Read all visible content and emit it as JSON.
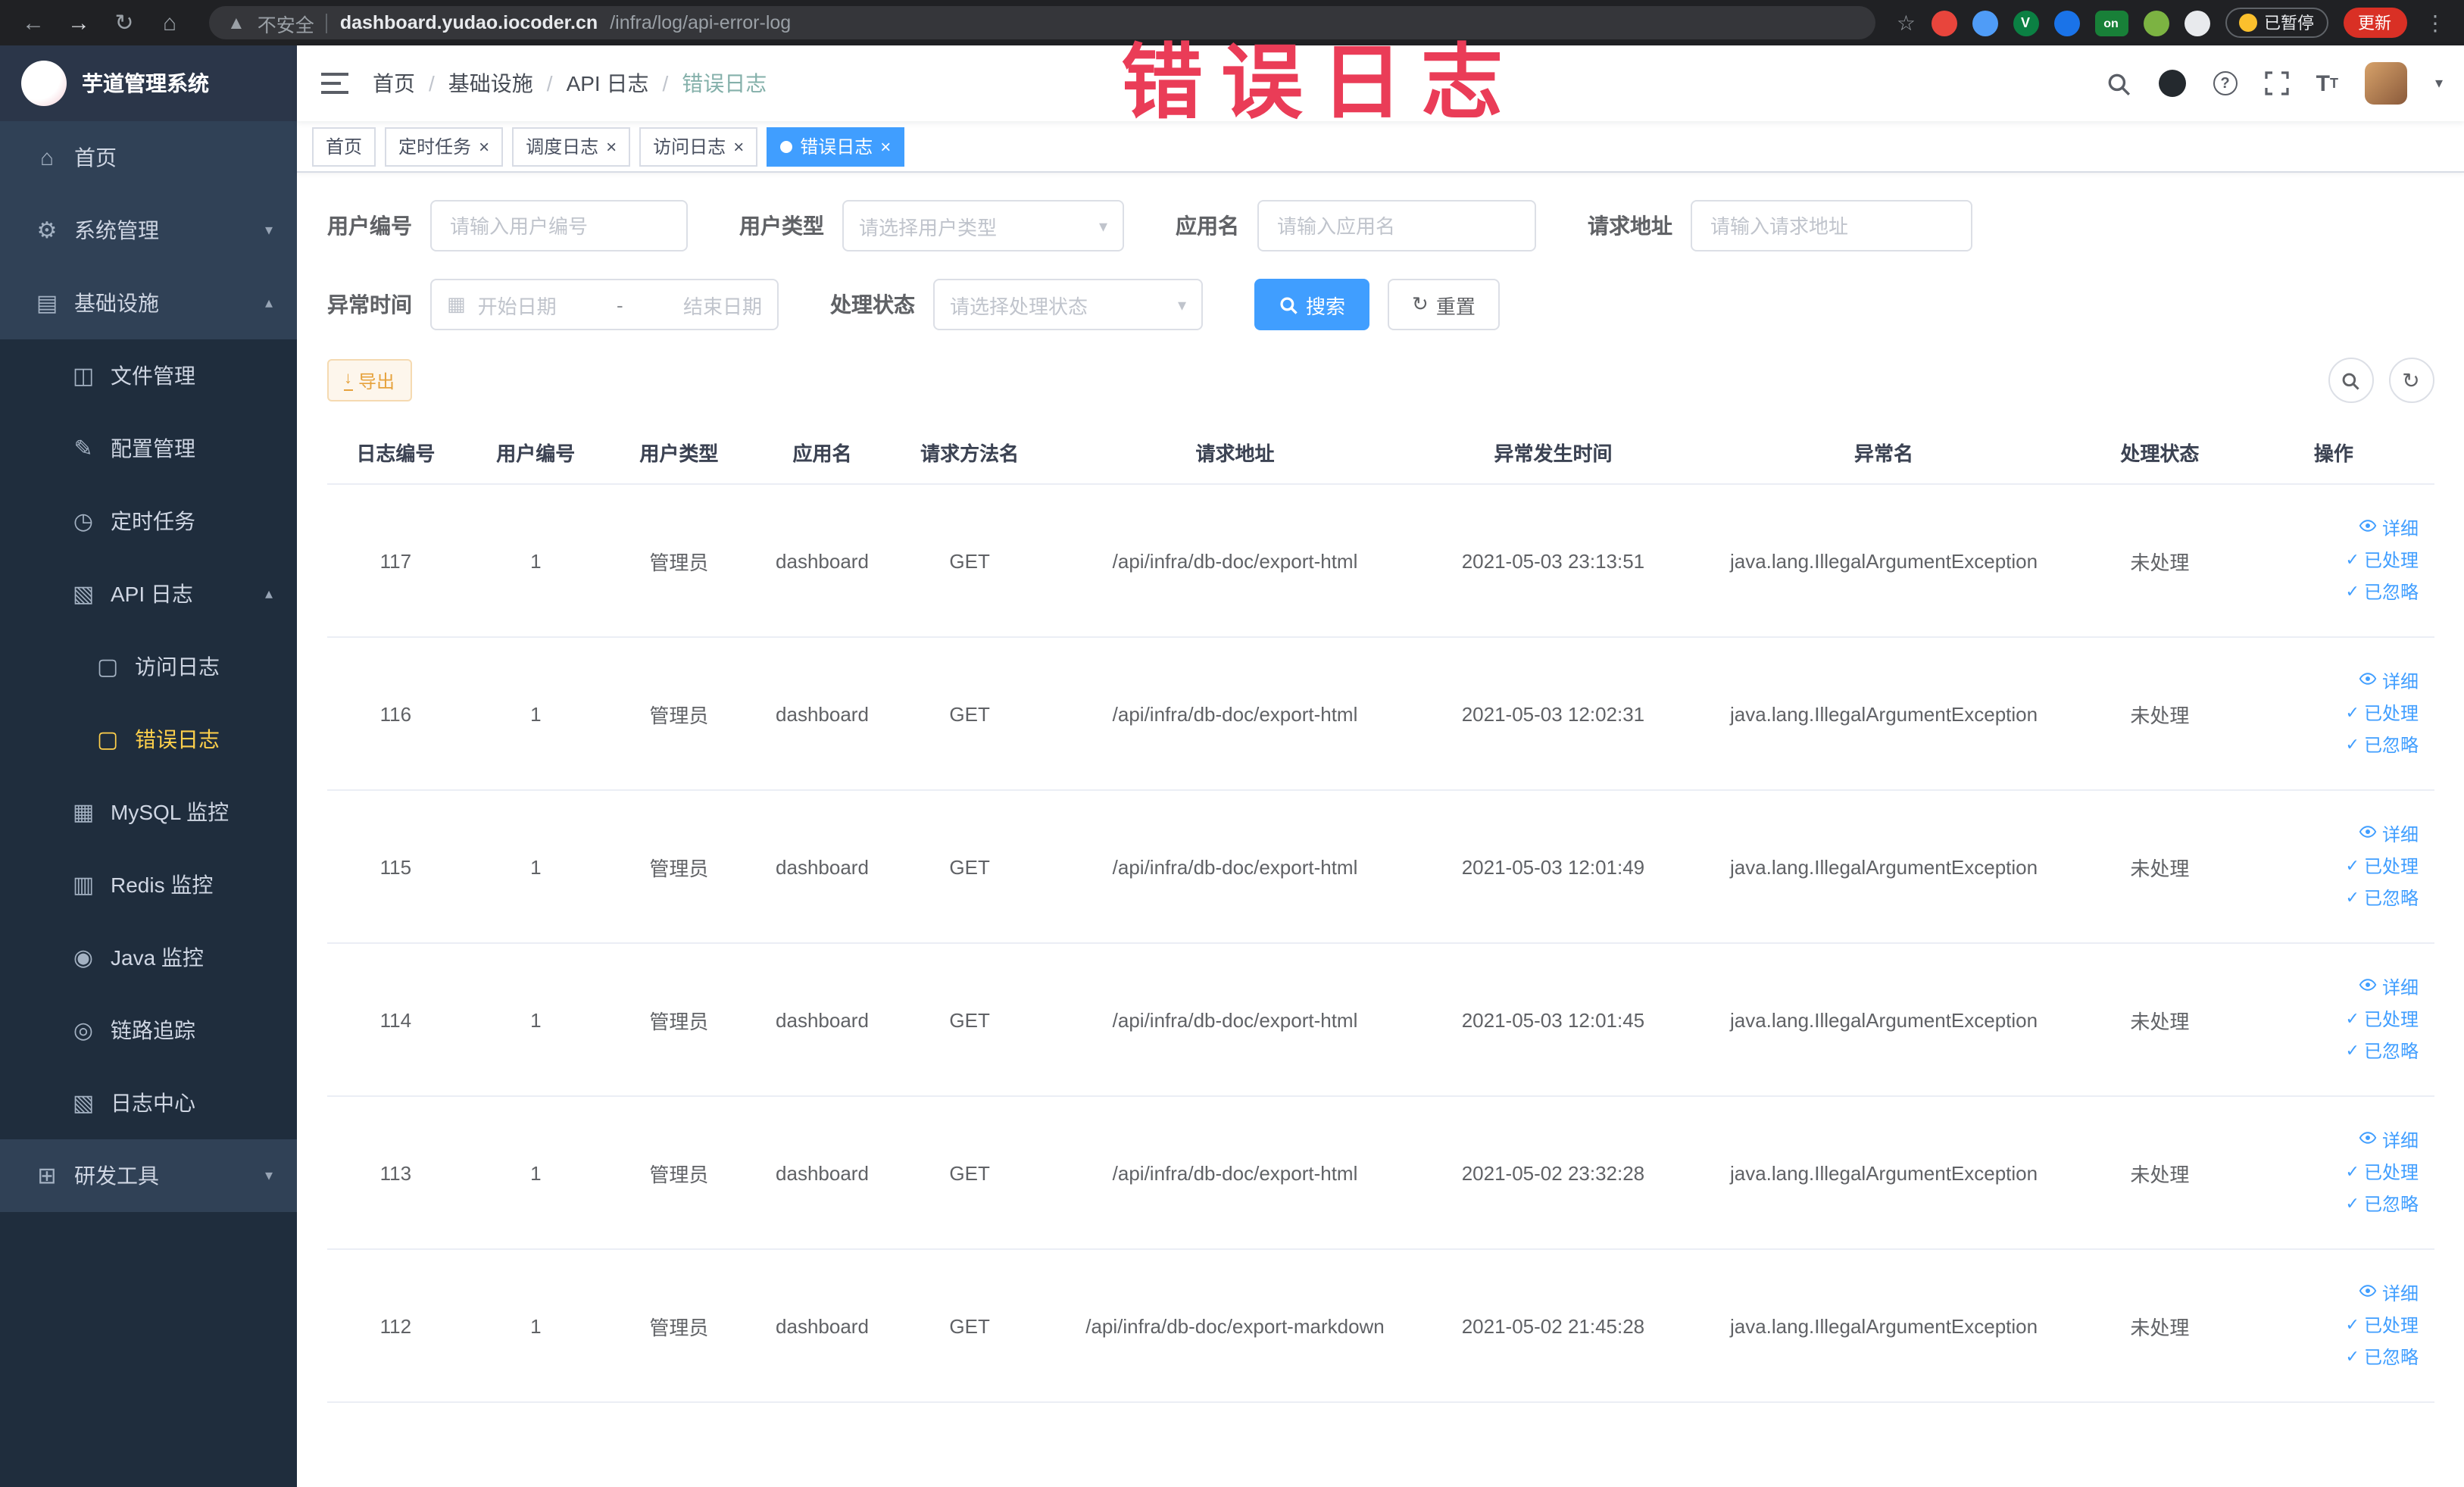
{
  "browser": {
    "security_label": "不安全",
    "url_domain": "dashboard.yudao.iocoder.cn",
    "url_path": "/infra/log/api-error-log",
    "ext_v_label": "V",
    "ext_on_label": "on",
    "paused_badge": "已暂停",
    "update_button": "更新"
  },
  "annotation": {
    "text": "错误日志"
  },
  "sidebar": {
    "logo_title": "芋道管理系统",
    "items": [
      {
        "key": "home",
        "label": "首页",
        "icon": "home-icon",
        "level": 1
      },
      {
        "key": "system",
        "label": "系统管理",
        "icon": "gear-icon",
        "level": 1,
        "expandable": true,
        "expanded": false
      },
      {
        "key": "infra",
        "label": "基础设施",
        "icon": "infra-icon",
        "level": 1,
        "expandable": true,
        "expanded": true
      },
      {
        "key": "file",
        "label": "文件管理",
        "icon": "file-icon",
        "level": 2
      },
      {
        "key": "config",
        "label": "配置管理",
        "icon": "config-icon",
        "level": 2
      },
      {
        "key": "job",
        "label": "定时任务",
        "icon": "timer-icon",
        "level": 2
      },
      {
        "key": "api-log",
        "label": "API 日志",
        "icon": "api-log-icon",
        "level": 2,
        "expandable": true,
        "expanded": true
      },
      {
        "key": "access-log",
        "label": "访问日志",
        "icon": "doc-icon",
        "level": 3
      },
      {
        "key": "error-log",
        "label": "错误日志",
        "icon": "doc-icon",
        "level": 3,
        "active": true
      },
      {
        "key": "mysql",
        "label": "MySQL 监控",
        "icon": "mysql-icon",
        "level": 2
      },
      {
        "key": "redis",
        "label": "Redis 监控",
        "icon": "redis-icon",
        "level": 2
      },
      {
        "key": "java",
        "label": "Java 监控",
        "icon": "java-icon",
        "level": 2
      },
      {
        "key": "trace",
        "label": "链路追踪",
        "icon": "trace-icon",
        "level": 2
      },
      {
        "key": "log-center",
        "label": "日志中心",
        "icon": "log-center-icon",
        "level": 2
      },
      {
        "key": "devtools",
        "label": "研发工具",
        "icon": "devtools-icon",
        "level": 1,
        "expandable": true,
        "expanded": false
      }
    ]
  },
  "breadcrumb": {
    "items": [
      "首页",
      "基础设施",
      "API 日志",
      "错误日志"
    ]
  },
  "tabs": [
    {
      "key": "home",
      "label": "首页",
      "closable": false,
      "active": false
    },
    {
      "key": "job",
      "label": "定时任务",
      "closable": true,
      "active": false
    },
    {
      "key": "job-log",
      "label": "调度日志",
      "closable": true,
      "active": false
    },
    {
      "key": "access-log",
      "label": "访问日志",
      "closable": true,
      "active": false
    },
    {
      "key": "error-log",
      "label": "错误日志",
      "closable": true,
      "active": true
    }
  ],
  "filters": {
    "user_id": {
      "label": "用户编号",
      "placeholder": "请输入用户编号"
    },
    "user_type": {
      "label": "用户类型",
      "placeholder": "请选择用户类型"
    },
    "app_name": {
      "label": "应用名",
      "placeholder": "请输入应用名"
    },
    "request_url": {
      "label": "请求地址",
      "placeholder": "请输入请求地址"
    },
    "exception_time": {
      "label": "异常时间",
      "start_placeholder": "开始日期",
      "separator": "-",
      "end_placeholder": "结束日期"
    },
    "process_status": {
      "label": "处理状态",
      "placeholder": "请选择处理状态"
    },
    "search_button": "搜索",
    "reset_button": "重置"
  },
  "toolbar": {
    "export_button": "导出"
  },
  "table": {
    "columns": [
      "日志编号",
      "用户编号",
      "用户类型",
      "应用名",
      "请求方法名",
      "请求地址",
      "异常发生时间",
      "异常名",
      "处理状态",
      "操作"
    ],
    "actions": [
      "详细",
      "已处理",
      "已忽略"
    ],
    "rows": [
      {
        "id": "117",
        "user_id": "1",
        "user_type": "管理员",
        "app": "dashboard",
        "method": "GET",
        "url": "/api/infra/db-doc/export-html",
        "time": "2021-05-03 23:13:51",
        "exception": "java.lang.IllegalArgumentException",
        "status": "未处理"
      },
      {
        "id": "116",
        "user_id": "1",
        "user_type": "管理员",
        "app": "dashboard",
        "method": "GET",
        "url": "/api/infra/db-doc/export-html",
        "time": "2021-05-03 12:02:31",
        "exception": "java.lang.IllegalArgumentException",
        "status": "未处理"
      },
      {
        "id": "115",
        "user_id": "1",
        "user_type": "管理员",
        "app": "dashboard",
        "method": "GET",
        "url": "/api/infra/db-doc/export-html",
        "time": "2021-05-03 12:01:49",
        "exception": "java.lang.IllegalArgumentException",
        "status": "未处理"
      },
      {
        "id": "114",
        "user_id": "1",
        "user_type": "管理员",
        "app": "dashboard",
        "method": "GET",
        "url": "/api/infra/db-doc/export-html",
        "time": "2021-05-03 12:01:45",
        "exception": "java.lang.IllegalArgumentException",
        "status": "未处理"
      },
      {
        "id": "113",
        "user_id": "1",
        "user_type": "管理员",
        "app": "dashboard",
        "method": "GET",
        "url": "/api/infra/db-doc/export-html",
        "time": "2021-05-02 23:32:28",
        "exception": "java.lang.IllegalArgumentException",
        "status": "未处理"
      },
      {
        "id": "112",
        "user_id": "1",
        "user_type": "管理员",
        "app": "dashboard",
        "method": "GET",
        "url": "/api/infra/db-doc/export-markdown",
        "time": "2021-05-02 21:45:28",
        "exception": "java.lang.IllegalArgumentException",
        "status": "未处理"
      }
    ]
  }
}
